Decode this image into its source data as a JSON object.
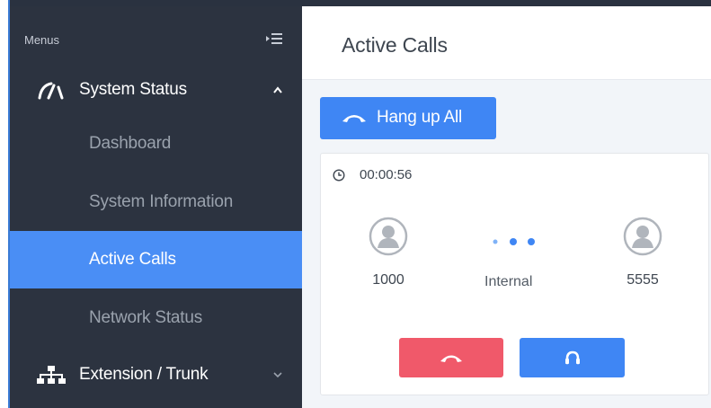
{
  "sidebar": {
    "menus_label": "Menus",
    "sections": [
      {
        "label": "System Status",
        "icon": "speedometer-icon",
        "expanded": true
      },
      {
        "label": "Extension / Trunk",
        "icon": "network-tree-icon",
        "expanded": false
      }
    ],
    "sub_items": [
      {
        "label": "Dashboard"
      },
      {
        "label": "System Information"
      },
      {
        "label": "Active Calls",
        "active": true
      },
      {
        "label": "Network Status"
      }
    ]
  },
  "main": {
    "title": "Active Calls",
    "hangup_all_label": "Hang up All",
    "call": {
      "duration": "00:00:56",
      "caller": "1000",
      "type": "Internal",
      "callee": "5555"
    }
  },
  "colors": {
    "sidebar_bg": "#2c3340",
    "accent": "#4a8ef5",
    "button_blue": "#3f86f4",
    "hangup_red": "#f0596a"
  }
}
